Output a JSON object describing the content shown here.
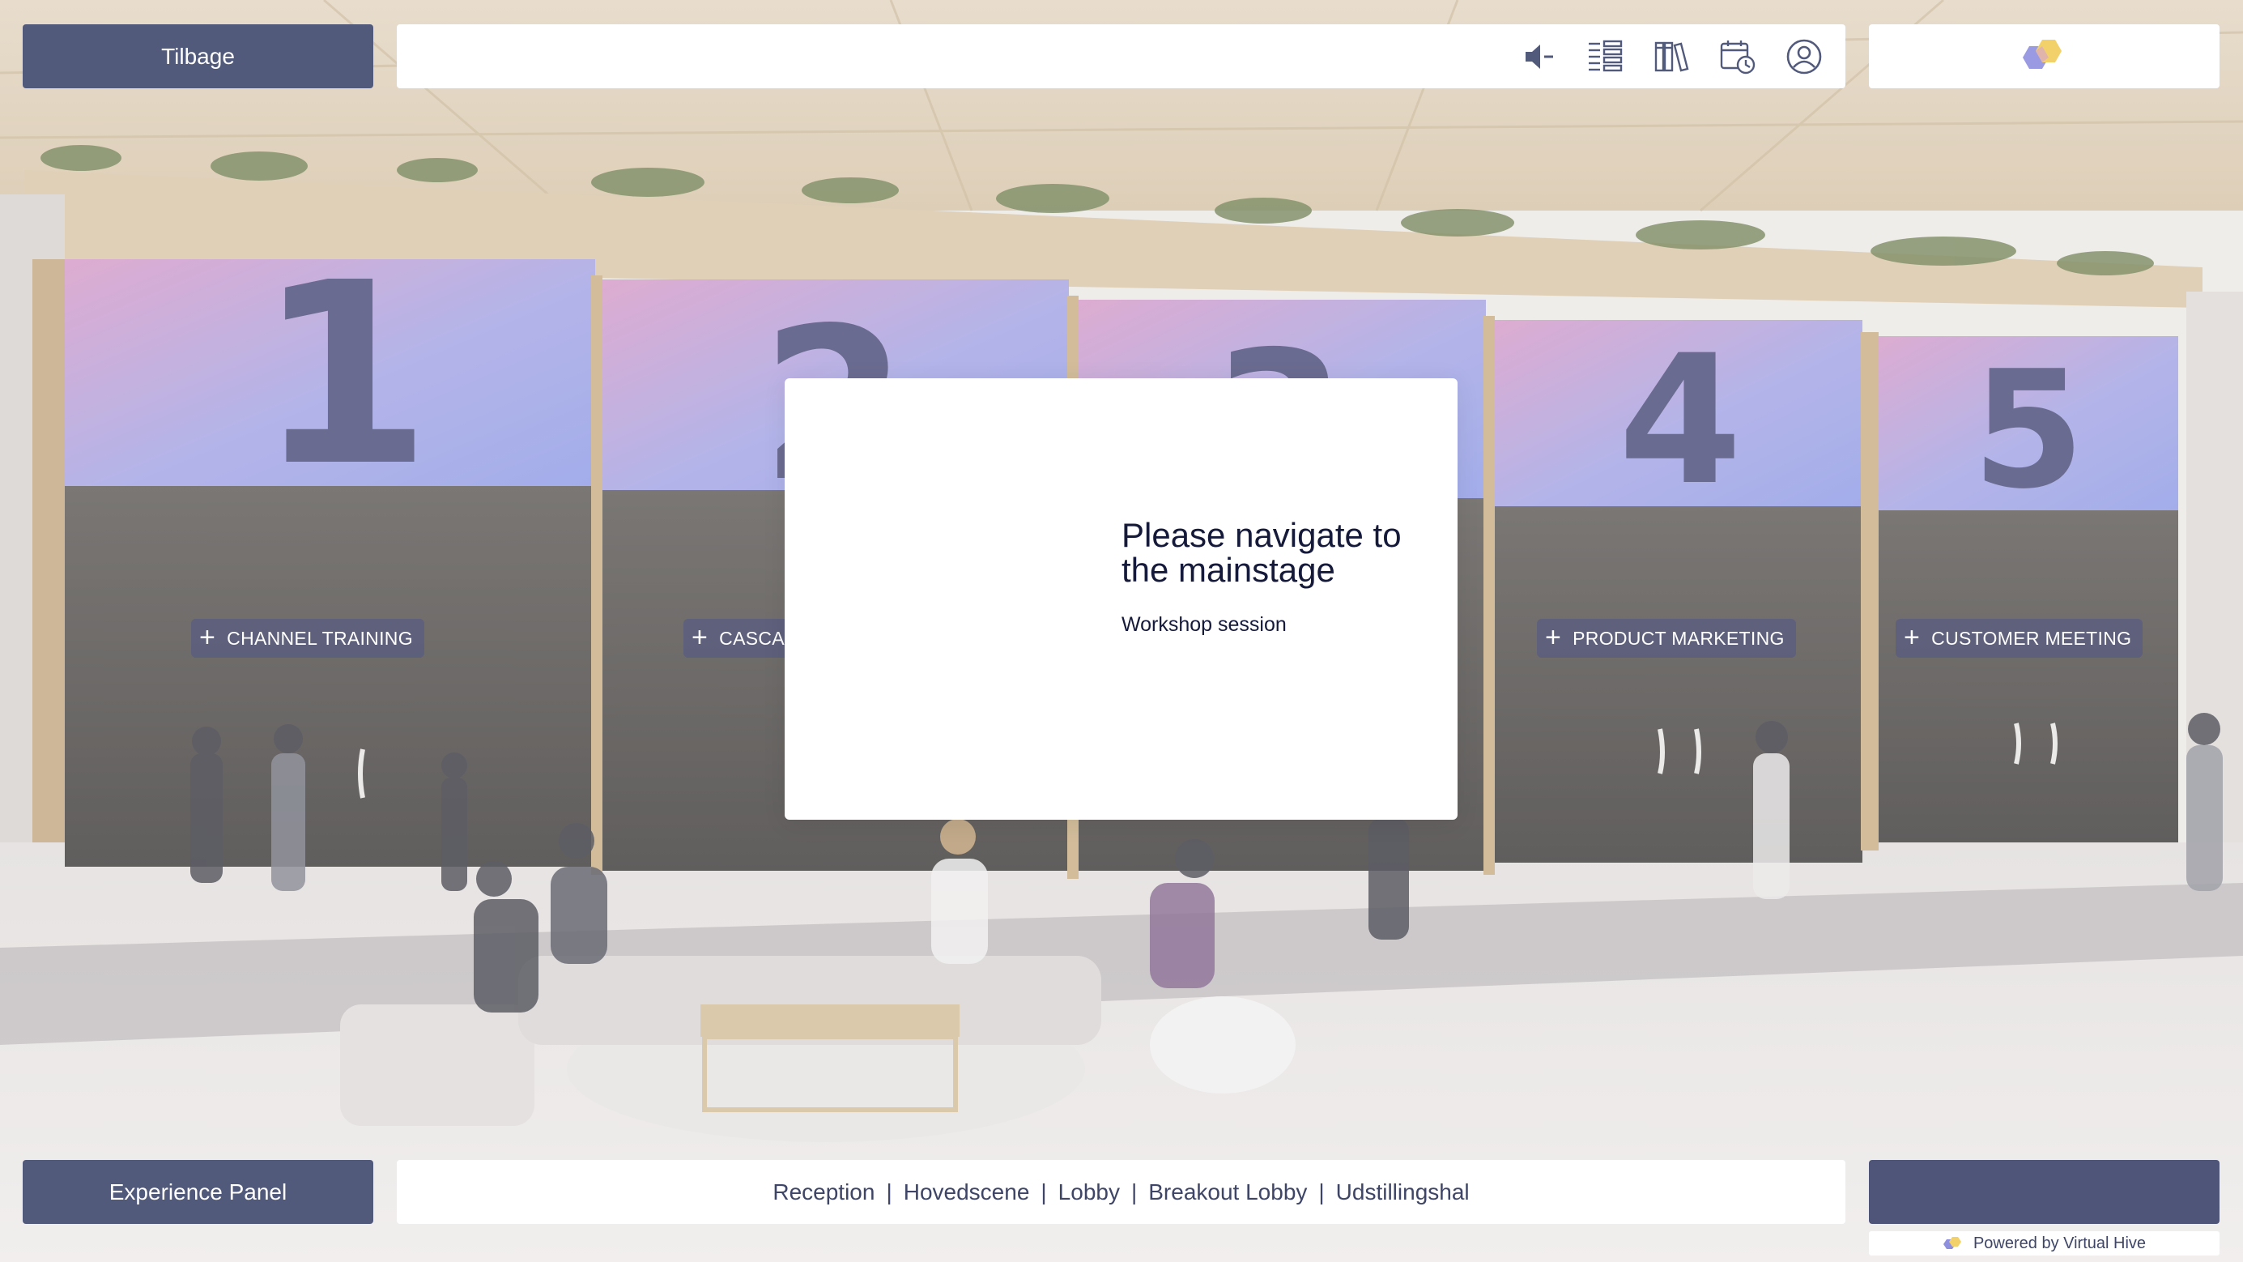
{
  "header": {
    "left_button_label": "Tilbage",
    "toolbar_icons": [
      "speaker-icon",
      "agenda-list-icon",
      "library-icon",
      "calendar-clock-icon",
      "user-profile-icon"
    ],
    "logo": "virtual-hive-logo"
  },
  "rooms": [
    {
      "number": "1",
      "label": "CHANNEL TRAINING"
    },
    {
      "number": "2",
      "label": "CASCA"
    },
    {
      "number": "3",
      "label": ""
    },
    {
      "number": "4",
      "label": "PRODUCT MARKETING"
    },
    {
      "number": "5",
      "label": "CUSTOMER MEETING"
    }
  ],
  "modal": {
    "title": "Please navigate to the mainstage",
    "subtitle": "Workshop session"
  },
  "footer": {
    "left_button_label": "Experience Panel",
    "nav": [
      "Reception",
      "Hovedscene",
      "Lobby",
      "Breakout Lobby",
      "Udstillingshal"
    ],
    "powered_by": "Powered by Virtual Hive"
  },
  "colors": {
    "accent": "#525a7c",
    "accent_dark": "#4f5479",
    "text_dark": "#15193a",
    "banner_blue": "#8f9ce6",
    "banner_pink": "#d79ac7"
  }
}
